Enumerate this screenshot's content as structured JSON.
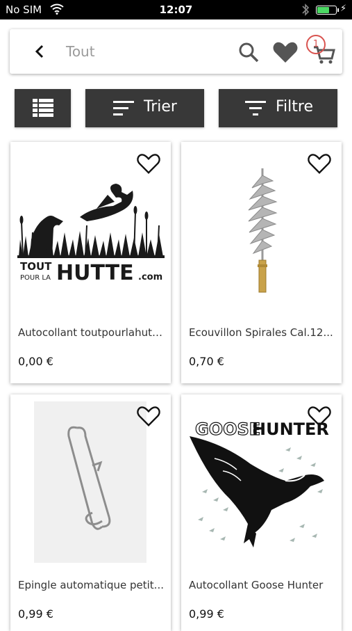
{
  "status_bar": {
    "carrier": "No SIM",
    "time": "12:07",
    "battery_level": 0.6,
    "battery_color": "#4cd964"
  },
  "search_bar": {
    "text": "Tout",
    "back_icon": "chevron-left-icon",
    "search_icon": "search-icon",
    "favorites_icon": "heart-filled-icon",
    "cart_icon": "cart-icon",
    "cart_count": "1",
    "badge_color": "#d9534f"
  },
  "toolbar": {
    "list_view_icon": "list-icon",
    "sort_label": "Trier",
    "filter_label": "Filtre",
    "button_color": "#383838"
  },
  "products": [
    {
      "title": "Autocollant toutpourlahutt...",
      "price": "0,00 €",
      "image_logo_line1": "TOUT",
      "image_logo_line2": "POUR LA",
      "image_logo_word": "HUTTE",
      "image_logo_suffix": ".com"
    },
    {
      "title": "Ecouvillon Spirales Cal.12...",
      "price": "0,70 €"
    },
    {
      "title": "Epingle automatique petit...",
      "price": "0,99 €"
    },
    {
      "title": "Autocollant Goose Hunter",
      "price": "0,99 €",
      "image_logo_word1": "GOOSE",
      "image_logo_word2": "HUNTER"
    }
  ]
}
